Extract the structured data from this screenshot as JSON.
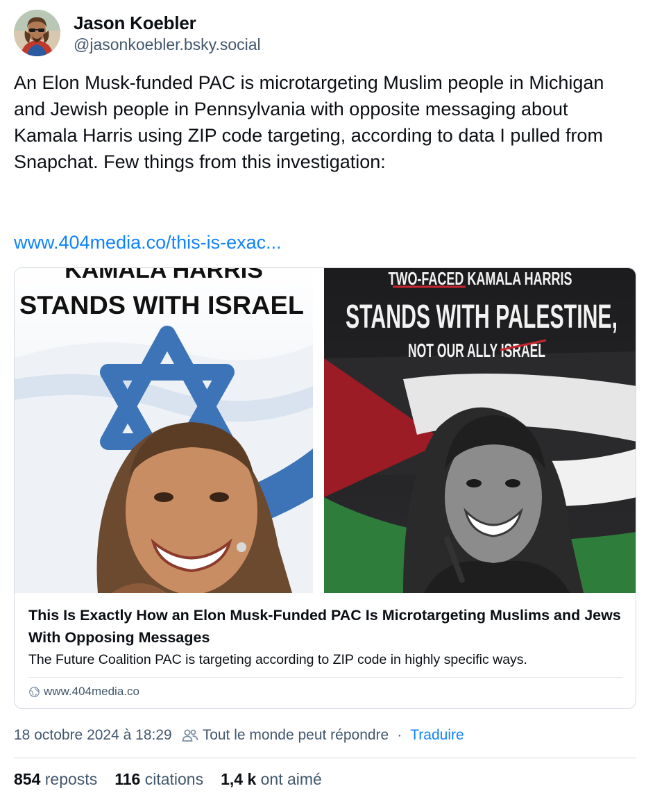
{
  "author": {
    "name": "Jason Koebler",
    "handle": "@jasonkoebler.bsky.social",
    "avatar_icon": "user-avatar-photo"
  },
  "post": {
    "text": "An Elon Musk-funded PAC is microtargeting Muslim people in Michigan and Jewish people in Pennsylvania with opposite messaging about Kamala Harris using ZIP code targeting, according to data I pulled from Snapchat. Few things from this investigation:",
    "link": "www.404media.co/this-is-exac..."
  },
  "card": {
    "image": {
      "left_top_text": "KAMALA HARRIS",
      "left_headline": "STANDS WITH ISRAEL",
      "right_top_text": "TWO-FACED KAMALA HARRIS",
      "right_headline": "STANDS WITH PALESTINE,",
      "right_sub": "NOT OUR ALLY ISRAEL"
    },
    "title": "This Is Exactly How an Elon Musk-Funded PAC Is Microtargeting Muslims and Jews With Opposing Messages",
    "description": "The Future Coalition PAC is targeting according to ZIP code in highly specific ways.",
    "domain": "www.404media.co",
    "domain_icon": "globe-icon"
  },
  "meta": {
    "timestamp": "18 octobre 2024 à 18:29",
    "reply_setting": "Tout le monde peut répondre",
    "separator": "·",
    "translate": "Traduire",
    "reply_icon": "people-icon"
  },
  "stats": {
    "reposts_count": "854",
    "reposts_label": "reposts",
    "quotes_count": "116",
    "quotes_label": "citations",
    "likes_count": "1,4 k",
    "likes_label": "ont aimé"
  },
  "colors": {
    "link": "#1083fe",
    "muted": "#42576c",
    "text": "#0b0f14",
    "border": "#d4dbe2"
  }
}
